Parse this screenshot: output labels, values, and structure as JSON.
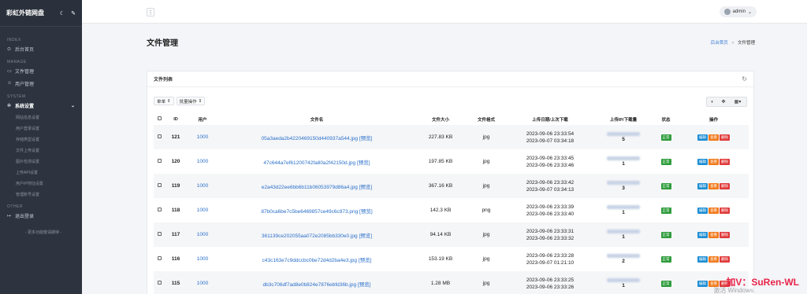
{
  "sidebar": {
    "brand": "彩虹外链网盘",
    "sections": {
      "index": "INDEX",
      "manage": "MANAGE",
      "system": "SYSTEM",
      "other": "OTHER"
    },
    "home": "后台首页",
    "file_manage": "文件管理",
    "user_manage": "用户管理",
    "system_settings": "系统设置",
    "sub_items": [
      "网站信息设置",
      "用户登录设置",
      "存储类型设置",
      "文件上传设置",
      "图片检测设置",
      "上传API设置",
      "用户IP地址设置",
      "管理账号设置"
    ],
    "logout": "退出登录",
    "more": "- 更多功能敬请期待 -"
  },
  "topbar": {
    "menu_glyph": "⋮",
    "user": "admin"
  },
  "page": {
    "title": "文件管理",
    "breadcrumb_home": "后台首页",
    "breadcrumb_sep": ">",
    "breadcrumb_current": "文件管理"
  },
  "card": {
    "title": "文件列表",
    "toolbar": {
      "single": "单单",
      "batch": "批量操作"
    }
  },
  "table": {
    "headers": [
      "",
      "ID",
      "用户",
      "文件名",
      "文件大小",
      "文件格式",
      "上传日期/上次下载",
      "上传IP/下载量",
      "状态",
      "操作"
    ],
    "rows": [
      {
        "id": "121",
        "user": "1000",
        "name": "05a3aeda2b4220469150d440937a544.jpg",
        "preview": "[预览]",
        "size": "227.83 KB",
        "type": "jpg",
        "up": "2023-09-06 23:33:54",
        "last": "2023-09-07 03:34:18",
        "downloads": "5"
      },
      {
        "id": "120",
        "user": "1000",
        "name": "47c644a7ef61200742fa80a2f42150d.jpg",
        "preview": "[预览]",
        "size": "197.85 KB",
        "type": "jpg",
        "up": "2023-09-06 23:33:45",
        "last": "2023-09-06 23:33:46",
        "downloads": "1"
      },
      {
        "id": "119",
        "user": "1000",
        "name": "e2a43d22ee6bb6b11b06053979d86a4.jpg",
        "preview": "[预览]",
        "size": "367.16 KB",
        "type": "jpg",
        "up": "2023-09-06 23:33:42",
        "last": "2023-09-07 03:34:13",
        "downloads": "3"
      },
      {
        "id": "118",
        "user": "1000",
        "name": "87b0ca6be7c5be6469857ce49c6c973.png",
        "preview": "[预览]",
        "size": "142.3 KB",
        "type": "png",
        "up": "2023-09-06 23:33:39",
        "last": "2023-09-06 23:33:40",
        "downloads": "1"
      },
      {
        "id": "117",
        "user": "1000",
        "name": "361139ce202055aa072e2085bb330e0.jpg",
        "preview": "[预览]",
        "size": "94.14 KB",
        "type": "jpg",
        "up": "2023-09-06 23:33:31",
        "last": "2023-09-06 23:33:32",
        "downloads": "1"
      },
      {
        "id": "116",
        "user": "1000",
        "name": "c43c163e7c9ddccbc0be72d4d2ba4e3.jpg",
        "preview": "[预览]",
        "size": "153.19 KB",
        "type": "jpg",
        "up": "2023-09-06 23:33:28",
        "last": "2023-09-07 01:21:10",
        "downloads": "2"
      },
      {
        "id": "115",
        "user": "1000",
        "name": "db3c706df7ad8e0b824e7876ebfd36b.jpg",
        "preview": "[预览]",
        "size": "1.28 MB",
        "type": "jpg",
        "up": "2023-09-06 23:33:25",
        "last": "2023-09-06 23:33:26",
        "downloads": "1"
      }
    ],
    "status_label": "正常",
    "op_labels": [
      "编辑",
      "查看",
      "删除"
    ]
  },
  "overlay": {
    "watermark": "加V：SuRen-WL",
    "activate": "激活 Windows"
  },
  "colors": {
    "sidebar_bg": "#2d343f",
    "link": "#2a6fc9",
    "status_green": "#2e9c3b",
    "btn_blue": "#1f8fd4",
    "btn_orange": "#f17a1b",
    "btn_red": "#e03a3a"
  }
}
